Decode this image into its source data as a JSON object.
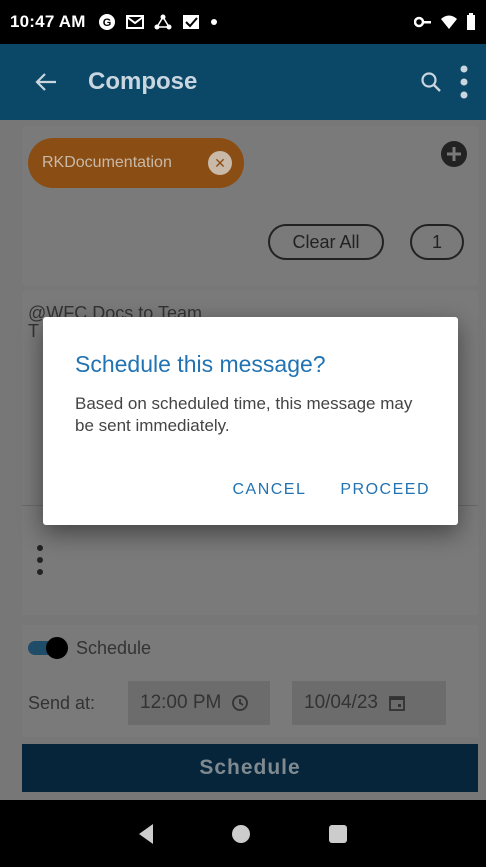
{
  "status_bar": {
    "time": "10:47 AM",
    "notification_icons": [
      "g-circle-icon",
      "mail-icon",
      "network-icon",
      "checkbox-mail-icon",
      "dot-icon"
    ],
    "right_icons": [
      "vpn-key-icon",
      "wifi-icon",
      "battery-icon"
    ]
  },
  "app_bar": {
    "title": "Compose",
    "back_icon": "arrow-back-icon",
    "search_icon": "search-icon",
    "menu_icon": "more-vert-icon",
    "color": "#0b4868"
  },
  "recipients": {
    "chip_label": "RKDocumentation",
    "chip_color": "#e37a1c",
    "clear_all_label": "Clear All",
    "count": "1"
  },
  "message": {
    "line1": "@WFC Docs to Team",
    "line2": "T"
  },
  "schedule": {
    "toggle_label": "Schedule",
    "send_at_label": "Send at:",
    "time_value": "12:00 PM",
    "date_value": "10/04/23",
    "button_label": "Schedule"
  },
  "dialog": {
    "title": "Schedule this message?",
    "body": "Based on scheduled time, this message may be sent immediately.",
    "cancel_label": "CANCEL",
    "proceed_label": "PROCEED",
    "accent": "#2273b3"
  }
}
